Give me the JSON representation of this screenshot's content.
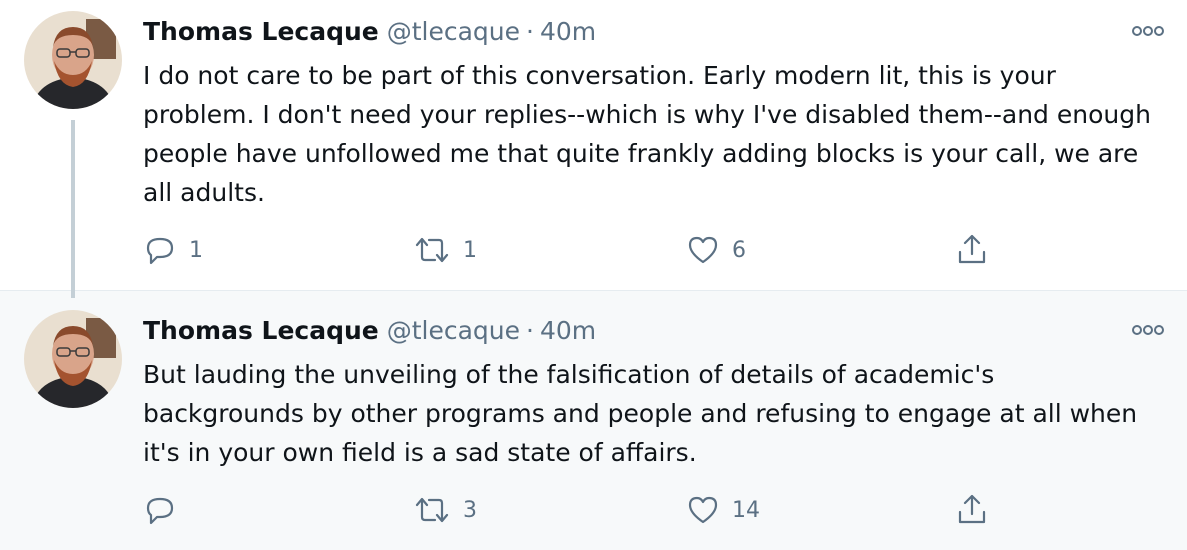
{
  "tweets": [
    {
      "name": "Thomas Lecaque",
      "handle": "@tlecaque",
      "separator": "·",
      "time": "40m",
      "text": "I do not care to be part of this conversation. Early modern lit, this is your problem. I don't need your replies--which is why I've disabled them--and enough people have unfollowed me that quite frankly adding blocks is your call, we are all adults.",
      "replies": "1",
      "retweets": "1",
      "likes": "6"
    },
    {
      "name": "Thomas Lecaque",
      "handle": "@tlecaque",
      "separator": "·",
      "time": "40m",
      "text": "But lauding the unveiling of the falsification of details of academic's backgrounds by other programs and people and refusing to engage at all when it's in your own field is a sad state of affairs.",
      "replies": "",
      "retweets": "3",
      "likes": "14"
    }
  ],
  "icons": {
    "reply": "reply-icon",
    "retweet": "retweet-icon",
    "like": "heart-icon",
    "share": "share-icon",
    "more": "more-options-icon",
    "avatar": "avatar"
  },
  "colors": {
    "text_primary": "#0f1419",
    "text_secondary": "#5b7083",
    "thread_line": "#c4cfd6",
    "highlight_background": "#f7f9fa"
  }
}
